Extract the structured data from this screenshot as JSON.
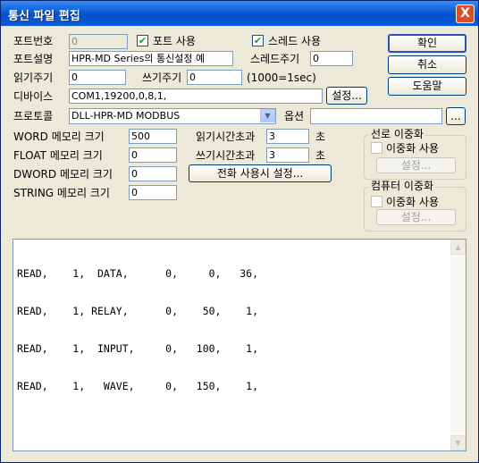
{
  "window": {
    "title": "통신 파일 편집",
    "close_symbol": "X"
  },
  "port_number": {
    "label": "포트번호",
    "value": "0"
  },
  "port_use": {
    "label": "포트 사용",
    "checked": true,
    "check_glyph": "✔"
  },
  "thread_use": {
    "label": "스레드 사용",
    "checked": true,
    "check_glyph": "✔"
  },
  "port_desc": {
    "label": "포트설명",
    "value": "HPR-MD Series의 통신설정 예"
  },
  "thread_period": {
    "label": "스레드주기",
    "value": "0"
  },
  "read_period": {
    "label": "읽기주기",
    "value": "0"
  },
  "write_period": {
    "label": "쓰기주기",
    "value": "0"
  },
  "period_unit": "(1000=1sec)",
  "device": {
    "label": "디바이스",
    "value": "COM1,19200,0,8,1,",
    "settings_label": "설정..."
  },
  "protocol": {
    "label": "프로토콜",
    "value": "DLL-HPR-MD MODBUS",
    "dropdown_glyph": "▼"
  },
  "option": {
    "label": "옵션",
    "value": "",
    "browse_label": "..."
  },
  "word_mem": {
    "label": "WORD 메모리 크기",
    "value": "500"
  },
  "float_mem": {
    "label": "FLOAT 메모리 크기",
    "value": "0"
  },
  "dword_mem": {
    "label": "DWORD 메모리 크기",
    "value": "0"
  },
  "string_mem": {
    "label": "STRING 메모리 크기",
    "value": "0"
  },
  "read_timeout": {
    "label": "읽기시간초과",
    "value": "3",
    "unit": "초"
  },
  "write_timeout": {
    "label": "쓰기시간초과",
    "value": "3",
    "unit": "초"
  },
  "phone_settings_label": "전화 사용시 설정...",
  "line_redundancy": {
    "group_label": "선로 이중화",
    "check_label": "이중화 사용",
    "checked": false,
    "settings_label": "설정..."
  },
  "computer_redundancy": {
    "group_label": "컴퓨터 이중화",
    "check_label": "이중화 사용",
    "checked": false,
    "settings_label": "설정..."
  },
  "buttons": {
    "ok": "확인",
    "cancel": "취소",
    "help": "도움말"
  },
  "editor": {
    "lines": [
      "READ,    1,  DATA,      0,     0,   36,",
      "READ,    1, RELAY,      0,    50,    1,",
      "READ,    1,  INPUT,     0,   100,    1,",
      "READ,    1,   WAVE,     0,   150,    1,"
    ]
  },
  "scrollbar": {
    "up_glyph": "▲",
    "down_glyph": "▼"
  }
}
